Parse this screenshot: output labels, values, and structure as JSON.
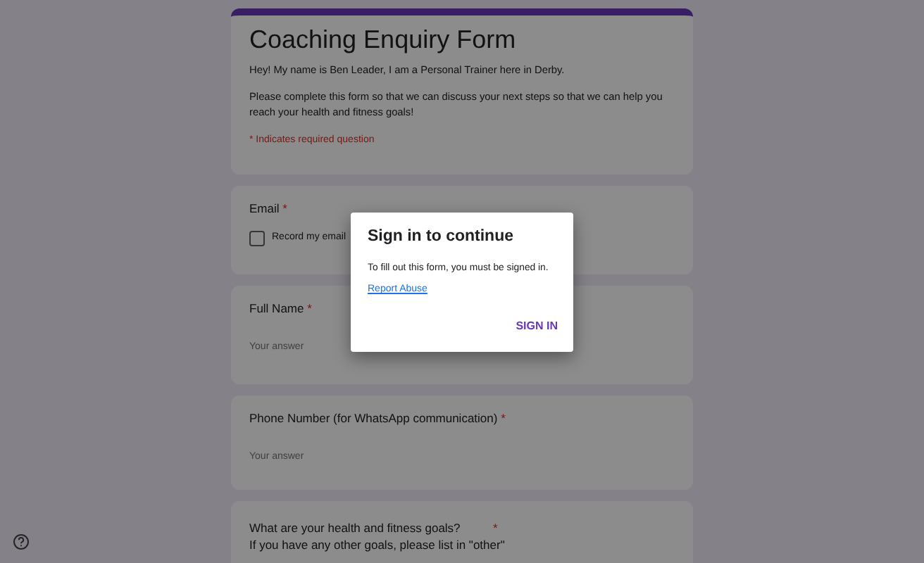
{
  "form": {
    "title": "Coaching Enquiry Form",
    "description": [
      "Hey! My name is Ben Leader, I am a Personal Trainer here in Derby.",
      "Please complete this form so that we can discuss your next steps so that we can help you reach your health and fitness goals!"
    ],
    "required_note": "* Indicates required question"
  },
  "questions": [
    {
      "kind": "email",
      "label": "Email",
      "required_mark": "*",
      "checkbox": {
        "label": "Record my email",
        "checked": false
      }
    },
    {
      "kind": "text",
      "label": "Full Name",
      "required_mark": "*",
      "placeholder": "Your answer"
    },
    {
      "kind": "text",
      "label": "Phone Number (for WhatsApp communication)",
      "required_mark": "*",
      "placeholder": "Your answer"
    },
    {
      "kind": "goals",
      "label": "What are your health and fitness goals?",
      "required_mark": "*",
      "hint": "If you have any other goals, please list in \"other\""
    }
  ],
  "dialog": {
    "title": "Sign in to continue",
    "message": "To fill out this form, you must be signed in.",
    "link": "Report Abuse",
    "button": "SIGN IN"
  }
}
